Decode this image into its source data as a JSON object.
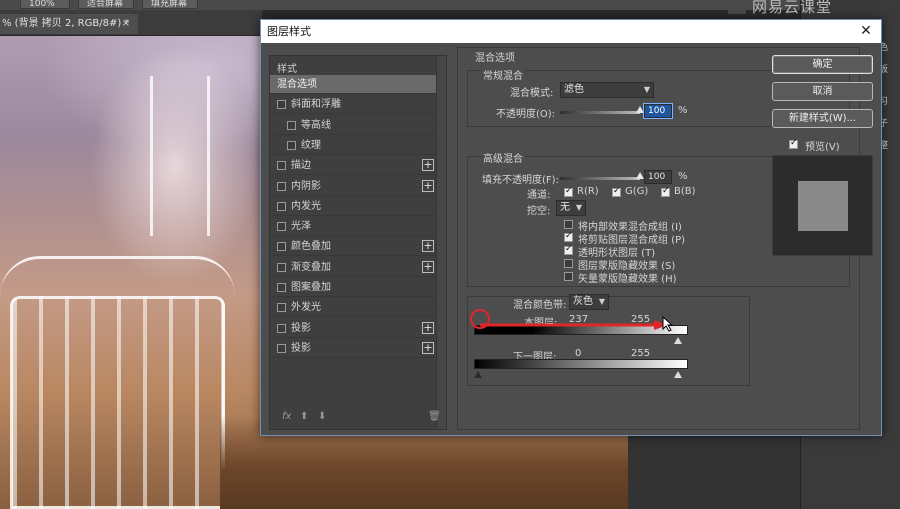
{
  "photoshop": {
    "toolbar": {
      "btn1": "100%",
      "btn2": "适合屏幕",
      "btn3": "填充屏幕"
    },
    "doc_tab": {
      "title": "% (背景 拷贝 2, RGB/8#) *",
      "close": "×"
    },
    "watermark": "网易云课堂",
    "right_panel_items": [
      "色",
      "板",
      "习",
      "子",
      "整"
    ]
  },
  "dialog": {
    "title": "图层样式",
    "close": "✕",
    "style_list": {
      "header": "样式",
      "items": [
        {
          "label": "混合选项",
          "active": true,
          "checkbox": false,
          "plus": false,
          "indent": false
        },
        {
          "label": "斜面和浮雕",
          "active": false,
          "checkbox": true,
          "plus": false,
          "indent": false
        },
        {
          "label": "等高线",
          "active": false,
          "checkbox": true,
          "plus": false,
          "indent": true
        },
        {
          "label": "纹理",
          "active": false,
          "checkbox": true,
          "plus": false,
          "indent": true
        },
        {
          "label": "描边",
          "active": false,
          "checkbox": true,
          "plus": true,
          "indent": false
        },
        {
          "label": "内阴影",
          "active": false,
          "checkbox": true,
          "plus": true,
          "indent": false
        },
        {
          "label": "内发光",
          "active": false,
          "checkbox": true,
          "plus": false,
          "indent": false
        },
        {
          "label": "光泽",
          "active": false,
          "checkbox": true,
          "plus": false,
          "indent": false
        },
        {
          "label": "颜色叠加",
          "active": false,
          "checkbox": true,
          "plus": true,
          "indent": false
        },
        {
          "label": "渐变叠加",
          "active": false,
          "checkbox": true,
          "plus": true,
          "indent": false
        },
        {
          "label": "图案叠加",
          "active": false,
          "checkbox": true,
          "plus": false,
          "indent": false
        },
        {
          "label": "外发光",
          "active": false,
          "checkbox": true,
          "plus": false,
          "indent": false
        },
        {
          "label": "投影",
          "active": false,
          "checkbox": true,
          "plus": true,
          "indent": false
        },
        {
          "label": "投影",
          "active": false,
          "checkbox": true,
          "plus": true,
          "indent": false
        }
      ],
      "footer": {
        "fx": "fx",
        "up": "⬆",
        "down": "⬇",
        "trash": "🗑"
      }
    },
    "blending": {
      "section_title": "混合选项",
      "general": {
        "title": "常规混合",
        "mode_label": "混合模式:",
        "mode_value": "滤色",
        "opacity_label": "不透明度(O):",
        "opacity_value": "100",
        "unit": "%",
        "opacity_level": 1.0
      },
      "advanced": {
        "title": "高级混合",
        "fill_label": "填充不透明度(F):",
        "fill_value": "100",
        "unit": "%",
        "fill_level": 1.0,
        "channels_label": "通道:",
        "channels": [
          {
            "label": "R(R)",
            "checked": true
          },
          {
            "label": "G(G)",
            "checked": true
          },
          {
            "label": "B(B)",
            "checked": true
          }
        ],
        "knockout_label": "挖空:",
        "knockout_value": "无",
        "options": [
          {
            "label": "将内部效果混合成组 (I)",
            "checked": false
          },
          {
            "label": "将剪贴图层混合成组 (P)",
            "checked": true
          },
          {
            "label": "透明形状图层 (T)",
            "checked": true
          },
          {
            "label": "图层蒙版隐藏效果 (S)",
            "checked": false
          },
          {
            "label": "矢量蒙版隐藏效果 (H)",
            "checked": false
          }
        ]
      },
      "blend_if": {
        "label": "混合颜色带:",
        "value": "灰色",
        "this_layer_label": "本图层:",
        "this_layer_low": "237",
        "this_layer_high": "255",
        "underlying_label": "下一图层:",
        "underlying_low": "0",
        "underlying_high": "255"
      }
    },
    "buttons": {
      "ok": "确定",
      "cancel": "取消",
      "new_style": "新建样式(W)...",
      "preview_label": "预览(V)",
      "preview_checked": true
    }
  },
  "colors": {
    "annotation_red": "#e0262a",
    "highlight_blue": "#1e56a0"
  }
}
